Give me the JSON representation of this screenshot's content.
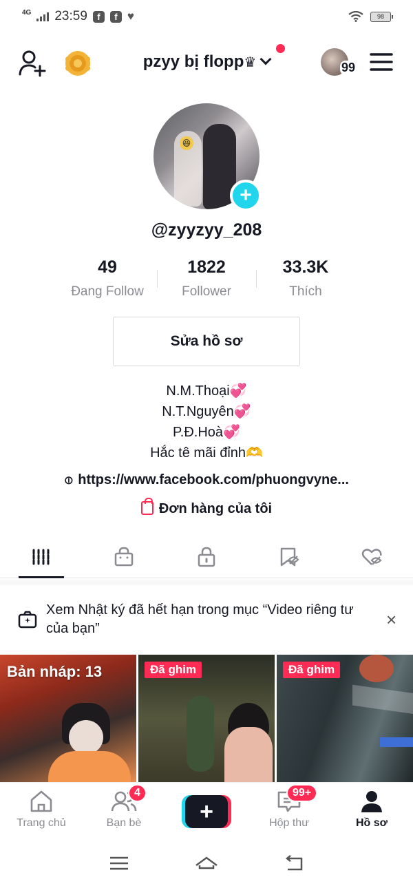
{
  "status_bar": {
    "network": "4G",
    "time": "23:59",
    "battery": "98"
  },
  "header": {
    "username": "pzyy bị flopp",
    "crown": "♛",
    "story_count": "99"
  },
  "profile": {
    "handle": "@zyyzyy_208",
    "stats": [
      {
        "value": "49",
        "label": "Đang Follow"
      },
      {
        "value": "1822",
        "label": "Follower"
      },
      {
        "value": "33.3K",
        "label": "Thích"
      }
    ],
    "edit_button": "Sửa hồ sơ",
    "bio": [
      "N.M.Thoại💞",
      "N.T.Nguyên💞",
      "P.Đ.Hoà💞",
      "Hắc tê mãi đỉnh🫶"
    ],
    "link": "https://www.facebook.com/phuongvyne...",
    "orders": "Đơn hàng của tôi"
  },
  "tabs": [
    "videos",
    "shop",
    "private",
    "reposts",
    "liked"
  ],
  "notice": {
    "text": "Xem Nhật ký đã hết hạn trong mục “Video riêng tư của bạn”",
    "close": "×"
  },
  "videos": [
    {
      "label": "Bản nháp: 13",
      "type": "draft"
    },
    {
      "label": "Đã ghim",
      "type": "pinned"
    },
    {
      "label": "Đã ghim",
      "type": "pinned"
    }
  ],
  "bottom_nav": {
    "home": "Trang chủ",
    "friends": "Bạn bè",
    "friends_badge": "4",
    "create": "+",
    "inbox": "Hộp thư",
    "inbox_badge": "99+",
    "profile": "Hồ sơ"
  },
  "colors": {
    "accent": "#fe2c55",
    "cyan": "#20d5ec",
    "text": "#161823",
    "muted": "#8a8b91"
  }
}
